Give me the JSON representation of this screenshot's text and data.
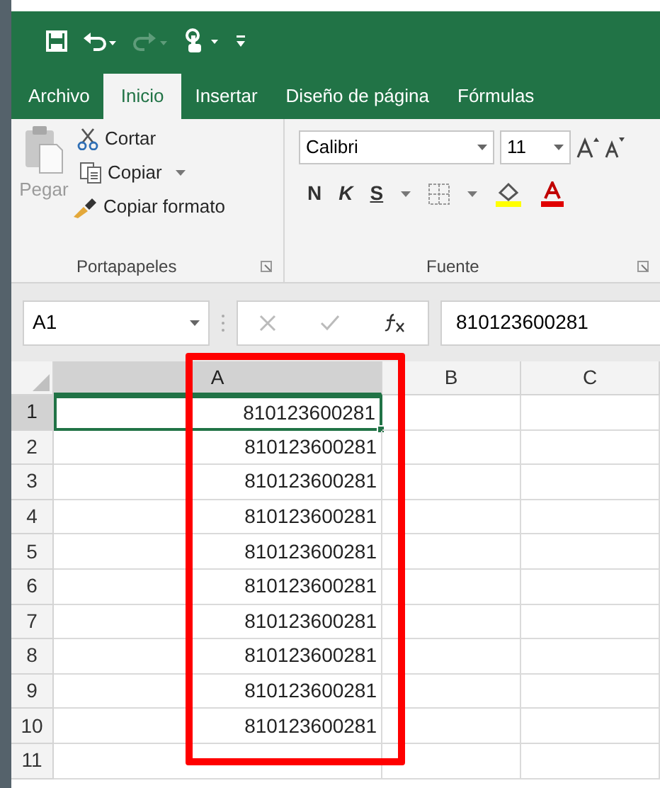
{
  "tabs": [
    {
      "label": "Archivo",
      "selected": false
    },
    {
      "label": "Inicio",
      "selected": true
    },
    {
      "label": "Insertar",
      "selected": false
    },
    {
      "label": "Diseño de página",
      "selected": false
    },
    {
      "label": "Fórmulas",
      "selected": false
    }
  ],
  "clipboard": {
    "paste": {
      "label": "Pegar",
      "disabled": true
    },
    "items": [
      "Cortar",
      "Copiar",
      "Copiar formato"
    ],
    "group_label": "Portapapeles"
  },
  "font": {
    "name": "Calibri",
    "size": "11",
    "bold": "N",
    "italic": "K",
    "underline": "S",
    "group_label": "Fuente"
  },
  "name_box": "A1",
  "formula": "810123600281",
  "columns": [
    {
      "label": "A",
      "selected": true
    },
    {
      "label": "B",
      "selected": false
    },
    {
      "label": "C",
      "selected": false
    }
  ],
  "rows": [
    {
      "number": "1",
      "selected": true,
      "value": "810123600281"
    },
    {
      "number": "2",
      "selected": false,
      "value": "810123600281"
    },
    {
      "number": "3",
      "selected": false,
      "value": "810123600281"
    },
    {
      "number": "4",
      "selected": false,
      "value": "810123600281"
    },
    {
      "number": "5",
      "selected": false,
      "value": "810123600281"
    },
    {
      "number": "6",
      "selected": false,
      "value": "810123600281"
    },
    {
      "number": "7",
      "selected": false,
      "value": "810123600281"
    },
    {
      "number": "8",
      "selected": false,
      "value": "810123600281"
    },
    {
      "number": "9",
      "selected": false,
      "value": "810123600281"
    },
    {
      "number": "10",
      "selected": false,
      "value": "810123600281"
    },
    {
      "number": "11",
      "selected": false
    }
  ]
}
